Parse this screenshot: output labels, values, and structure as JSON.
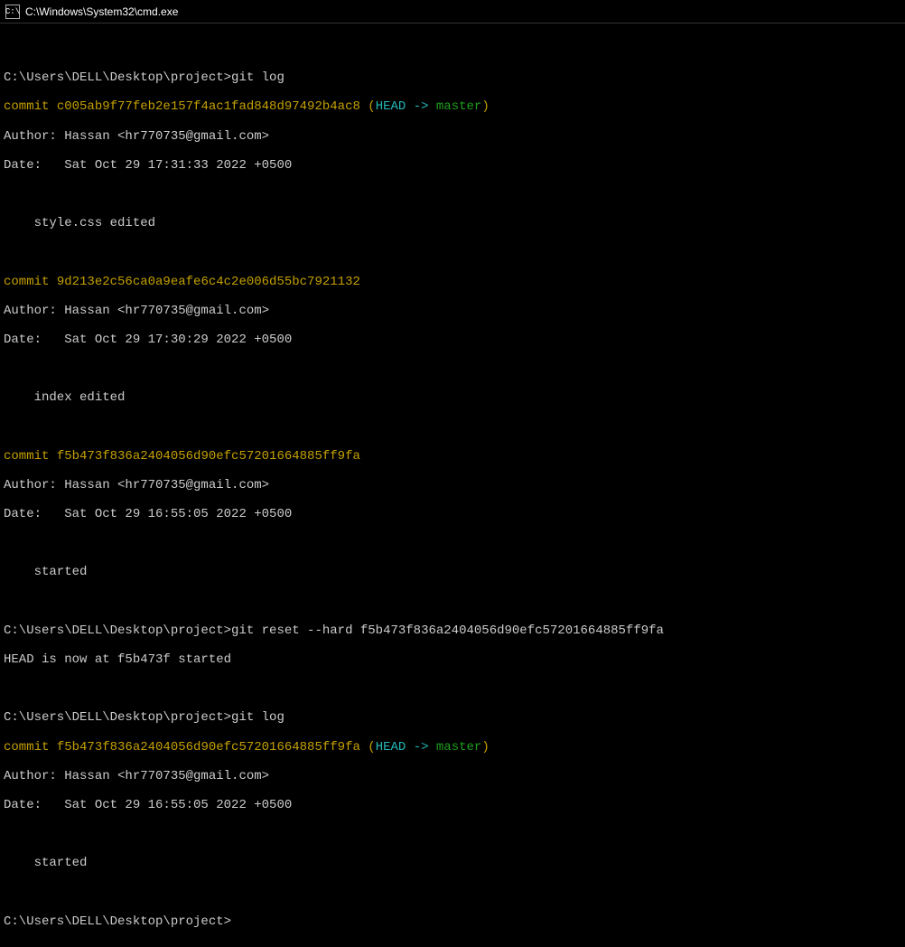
{
  "window": {
    "title": "C:\\Windows\\System32\\cmd.exe",
    "icon_label": "C:\\"
  },
  "term": {
    "blank0": " ",
    "prompt1": "C:\\Users\\DELL\\Desktop\\project>",
    "cmd1": "git log",
    "c1_commit_label": "commit ",
    "c1_hash": "c005ab9f77feb2e157f4ac1fad848d97492b4ac8",
    "c1_paren_open": " (",
    "c1_head": "HEAD -> ",
    "c1_branch": "master",
    "c1_paren_close": ")",
    "c1_author": "Author: Hassan <hr770735@gmail.com>",
    "c1_date": "Date:   Sat Oct 29 17:31:33 2022 +0500",
    "blank1": " ",
    "c1_msg": "    style.css edited",
    "blank2": " ",
    "c2_commit_label": "commit ",
    "c2_hash": "9d213e2c56ca0a9eafe6c4c2e006d55bc7921132",
    "c2_author": "Author: Hassan <hr770735@gmail.com>",
    "c2_date": "Date:   Sat Oct 29 17:30:29 2022 +0500",
    "blank3": " ",
    "c2_msg": "    index edited",
    "blank4": " ",
    "c3_commit_label": "commit ",
    "c3_hash": "f5b473f836a2404056d90efc57201664885ff9fa",
    "c3_author": "Author: Hassan <hr770735@gmail.com>",
    "c3_date": "Date:   Sat Oct 29 16:55:05 2022 +0500",
    "blank5": " ",
    "c3_msg": "    started",
    "blank6": " ",
    "prompt2": "C:\\Users\\DELL\\Desktop\\project>",
    "cmd2": "git reset --hard f5b473f836a2404056d90efc57201664885ff9fa",
    "reset_out": "HEAD is now at f5b473f started",
    "blank7": " ",
    "prompt3": "C:\\Users\\DELL\\Desktop\\project>",
    "cmd3": "git log",
    "c4_commit_label": "commit ",
    "c4_hash": "f5b473f836a2404056d90efc57201664885ff9fa",
    "c4_paren_open": " (",
    "c4_head": "HEAD -> ",
    "c4_branch": "master",
    "c4_paren_close": ")",
    "c4_author": "Author: Hassan <hr770735@gmail.com>",
    "c4_date": "Date:   Sat Oct 29 16:55:05 2022 +0500",
    "blank8": " ",
    "c4_msg": "    started",
    "blank9": " ",
    "prompt4": "C:\\Users\\DELL\\Desktop\\project>"
  }
}
